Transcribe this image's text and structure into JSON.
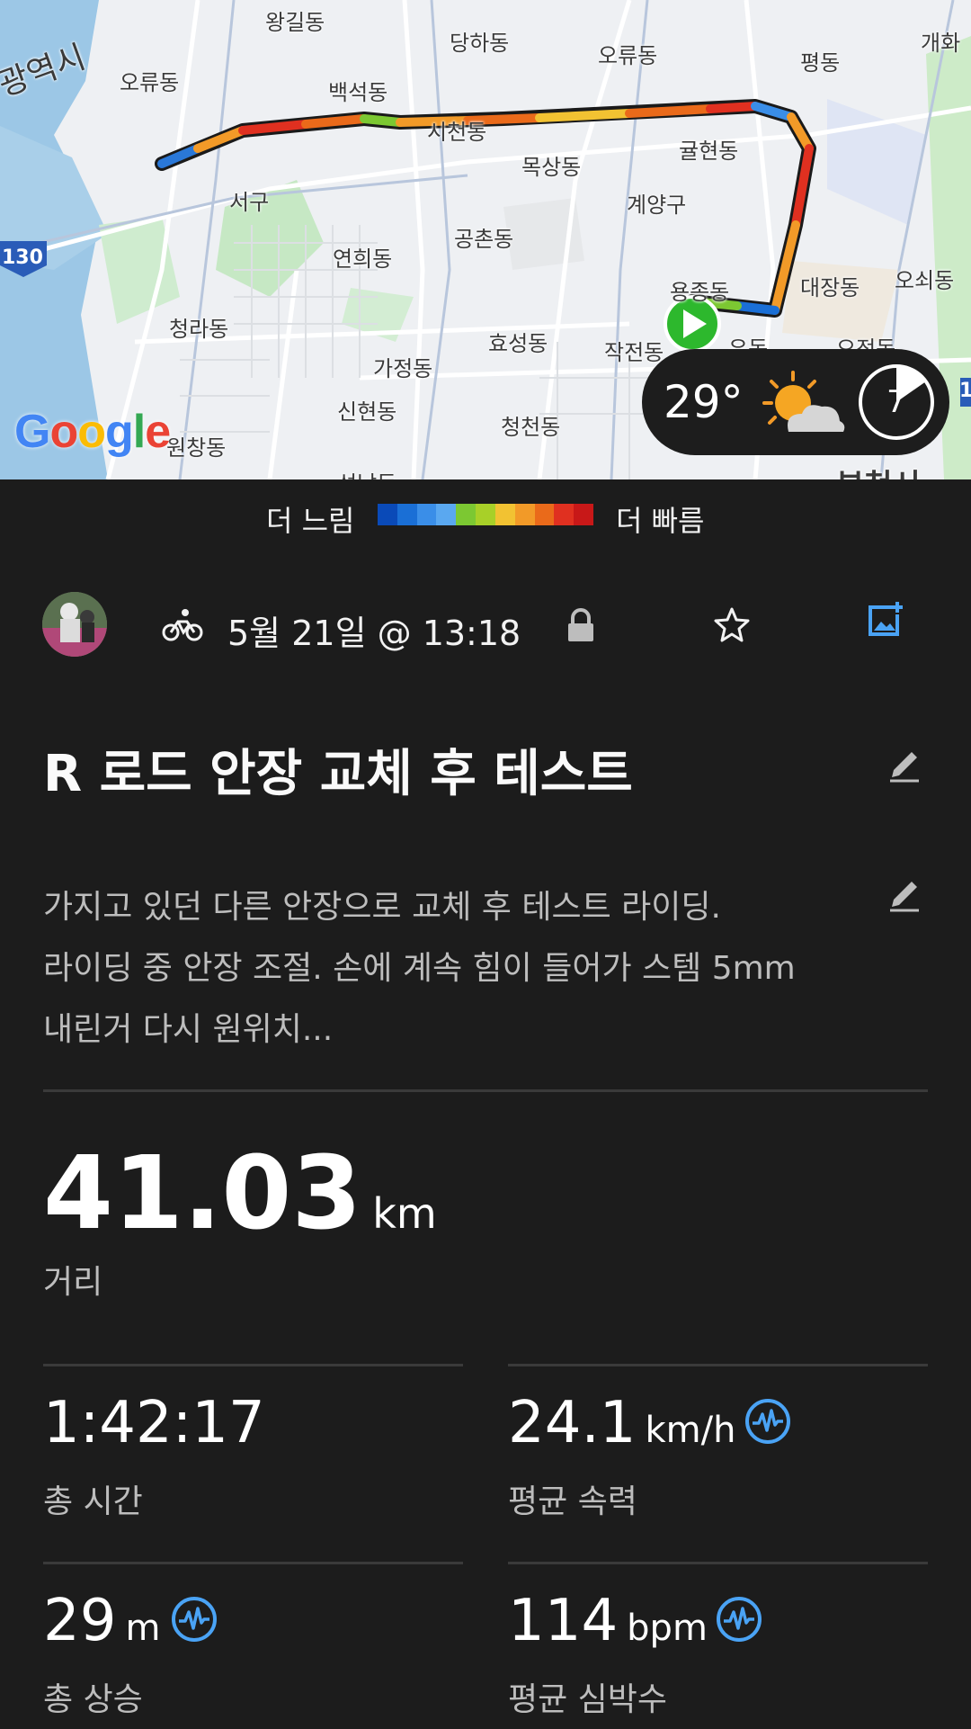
{
  "map": {
    "labels": [
      "왕길동",
      "당하동",
      "오류동",
      "평동",
      "개화",
      "광역시",
      "오류동",
      "백석동",
      "시천동",
      "목상동",
      "귤현동",
      "서구",
      "계양구",
      "공촌동",
      "연희동",
      "대장동",
      "오쇠동",
      "용종동",
      "청라동",
      "효성동",
      "작전동",
      "가정동",
      "유동",
      "오정동",
      "신현동",
      "청천동",
      "원창동",
      "석남동",
      "부천시"
    ],
    "highway": "130",
    "highway_right": "1",
    "google_logo": [
      "G",
      "o",
      "o",
      "g",
      "l",
      "e"
    ]
  },
  "weather": {
    "temperature": "29°",
    "wind_badge": "7",
    "icon": "partly-cloudy-icon"
  },
  "legend": {
    "slow": "더 느림",
    "fast": "더 빠름",
    "colors": [
      "#0a4ab8",
      "#1a6fd6",
      "#3a8ee8",
      "#5aa8f0",
      "#7cc832",
      "#a8d028",
      "#f2c232",
      "#f29a28",
      "#ea6a1a",
      "#e03020",
      "#c81818"
    ]
  },
  "activity": {
    "sport_icon": "bicycle-icon",
    "date": "5월 21일 @ 13:18",
    "title": "R 로드 안장 교체 후 테스트",
    "description_lines": [
      "가지고 있던 다른 안장으로 교체 후 테스트 라이딩.",
      "라이딩 중 안장 조절. 손에 계속 힘이 들어가 스템 5mm",
      "내린거 다시 원위치..."
    ]
  },
  "stats": {
    "distance": {
      "value": "41.03",
      "unit": "km",
      "label": "거리"
    },
    "total_time": {
      "value": "1:42:17",
      "label": "총 시간"
    },
    "avg_speed": {
      "value": "24.1",
      "unit": "km/h",
      "label": "평균 속력"
    },
    "total_ascent": {
      "value": "29",
      "unit": "m",
      "label": "총 상승"
    },
    "avg_hr": {
      "value": "114",
      "unit": "bpm",
      "label": "평균 심박수"
    }
  },
  "colors": {
    "background": "#1c1c1c",
    "accent_blue": "#4aa3f5",
    "start_green": "#2db82d"
  }
}
